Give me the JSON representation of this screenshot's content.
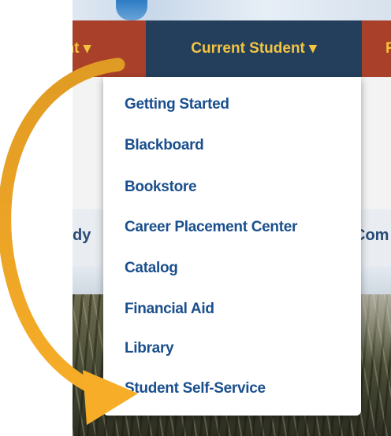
{
  "nav": {
    "prev_label": "ent",
    "prev_caret": "▾",
    "current_label": "Current Student",
    "current_caret": "▾",
    "next_label": "F"
  },
  "strip": {
    "left_text": "dy",
    "right_text": "Com"
  },
  "dropdown": {
    "items": [
      "Getting Started",
      "Blackboard",
      "Bookstore",
      "Career Placement Center",
      "Catalog",
      "Financial Aid",
      "Library",
      "Student Self-Service"
    ]
  },
  "colors": {
    "nav_current_bg": "#243f5c",
    "nav_other_bg": "#a8402a",
    "nav_text": "#f3c540",
    "link": "#1a4f8e",
    "arrow": "#f2a623"
  },
  "annotation": {
    "arrow_icon": "curved-arrow-icon"
  }
}
